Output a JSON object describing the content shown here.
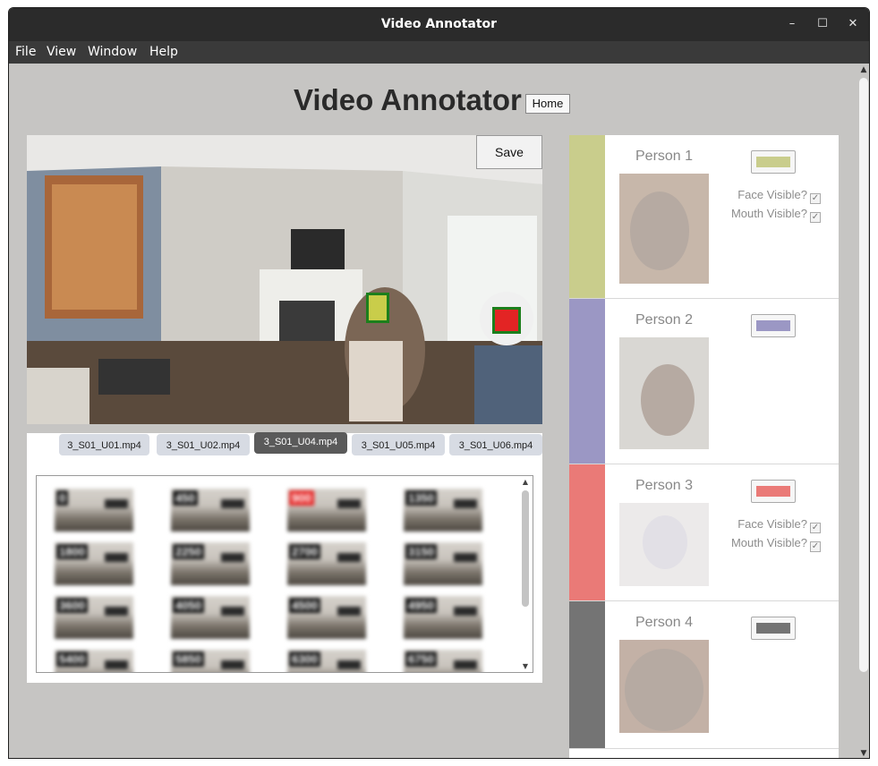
{
  "window": {
    "title": "Video Annotator"
  },
  "controls": {
    "minimize": "–",
    "maximize": "☐",
    "close": "✕"
  },
  "menu": {
    "items": [
      "File",
      "View",
      "Window",
      "Help"
    ]
  },
  "header": {
    "title": "Video Annotator",
    "home_label": "Home"
  },
  "video": {
    "save_label": "Save"
  },
  "tabs": [
    {
      "label": "3_S01_U01.mp4"
    },
    {
      "label": "3_S01_U02.mp4"
    },
    {
      "label": "3_S01_U04.mp4",
      "active": true
    },
    {
      "label": "3_S01_U05.mp4"
    },
    {
      "label": "3_S01_U06.mp4"
    }
  ],
  "thumbnails": [
    "0",
    "450",
    "900",
    "1350",
    "1800",
    "2250",
    "2700",
    "3150",
    "3600",
    "4050",
    "4500",
    "4950",
    "5400",
    "5850",
    "6300",
    "6750"
  ],
  "highlighted_thumbnail": "900",
  "persons": [
    {
      "name": "Person 1",
      "color": "#c9cd8c",
      "face_visible_label": "Face Visible?",
      "mouth_visible_label": "Mouth Visible?",
      "face_visible": true,
      "mouth_visible": true
    },
    {
      "name": "Person 2",
      "color": "#9b97c4"
    },
    {
      "name": "Person 3",
      "color": "#ea7a77",
      "face_visible_label": "Face Visible?",
      "mouth_visible_label": "Mouth Visible?",
      "face_visible": true,
      "mouth_visible": true
    },
    {
      "name": "Person 4",
      "color": "#747474"
    }
  ],
  "colors": {
    "annotation_box": "#1c7f1c",
    "box_fill_1": "#c9cd4a",
    "box_fill_3": "#e32424"
  }
}
